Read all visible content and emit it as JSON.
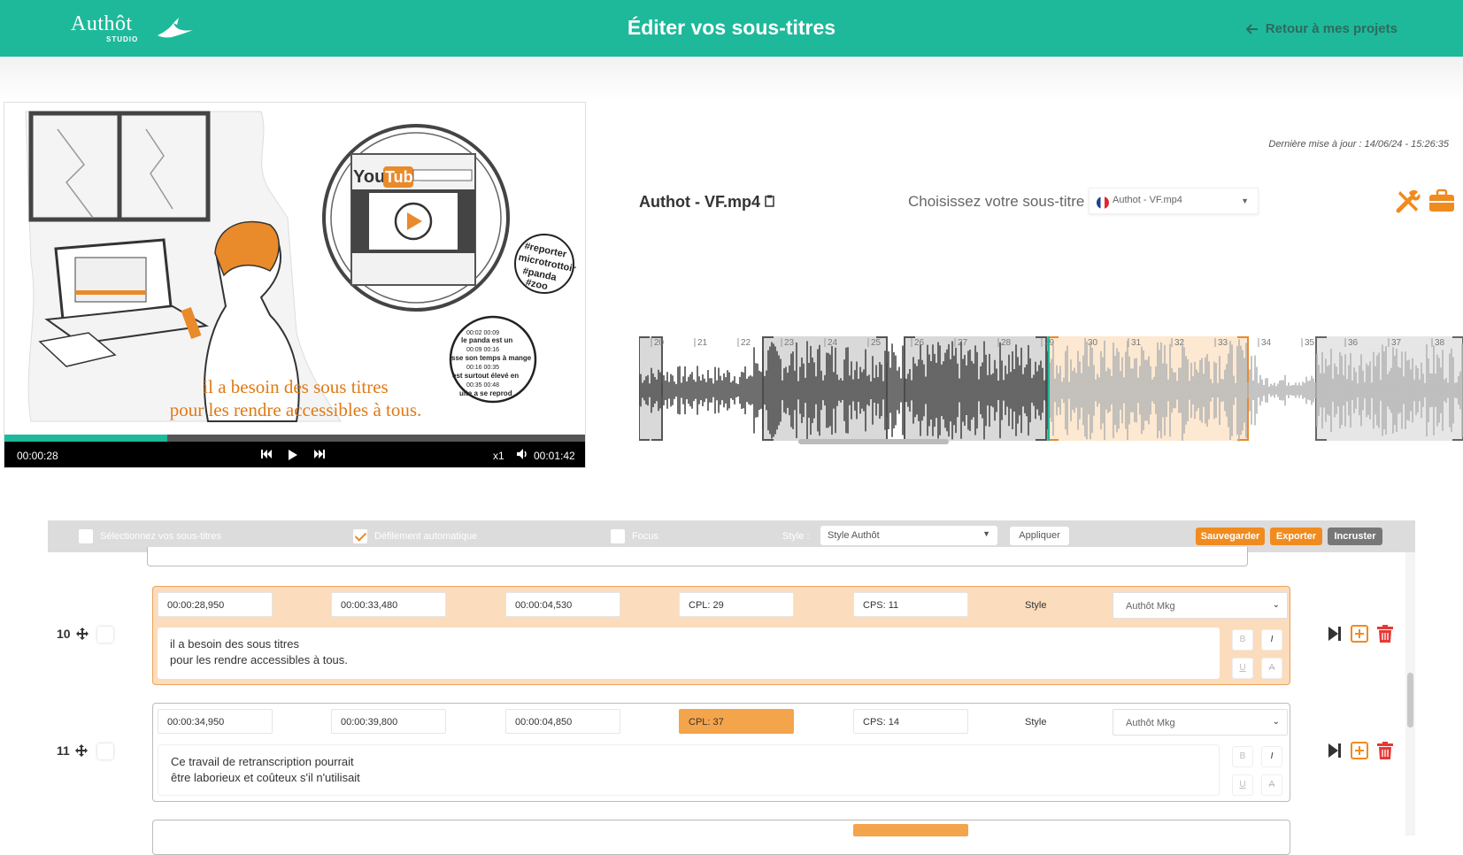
{
  "header": {
    "logo_text": "Authôt",
    "logo_sub": "STUDIO",
    "title": "Éditer vos sous-titres",
    "back_label": "Retour à mes projets"
  },
  "video": {
    "caption_line1": "il a besoin des sous titres",
    "caption_line2": "pour les rendre accessibles à tous.",
    "current_time": "00:00:28",
    "duration": "00:01:42",
    "speed": "x1",
    "progress": 0.28
  },
  "project": {
    "last_update": "Dernière mise à jour : 14/06/24 - 15:26:35",
    "filename": "Authot - VF.mp4",
    "choose_label": "Choisissez votre sous-titre",
    "selected_subtitle": "Authot - VF.mp4"
  },
  "waveform": {
    "ticks": [
      "20",
      "21",
      "22",
      "23",
      "24",
      "25",
      "26",
      "27",
      "28",
      "29",
      "30",
      "31",
      "32",
      "33",
      "34",
      "35",
      "36",
      "37",
      "38"
    ]
  },
  "toolbar": {
    "select_all": "Sélectionnez vos sous-titres",
    "auto_scroll": "Défilement automatique",
    "focus": "Focus",
    "style_label": "Style :",
    "style_value": "Style Authôt",
    "apply": "Appliquer",
    "save": "Sauvegarder",
    "export": "Exporter",
    "burn": "Incruster"
  },
  "subtitles": [
    {
      "number": "10",
      "start": "00:00:28,950",
      "end": "00:00:33,480",
      "duration": "00:00:04,530",
      "cpl": "CPL: 29",
      "cps": "CPS: 11",
      "style_label": "Style",
      "style": "Authôt Mkg",
      "line1": "il a besoin des sous titres",
      "line2": "pour les rendre accessibles à tous."
    },
    {
      "number": "11",
      "start": "00:00:34,950",
      "end": "00:00:39,800",
      "duration": "00:00:04,850",
      "cpl": "CPL: 37",
      "cps": "CPS: 14",
      "style_label": "Style",
      "style": "Authôt Mkg",
      "line1": "Ce travail de retranscription pourrait",
      "line2": "être laborieux et coûteux s'il n'utilisait"
    }
  ],
  "format_buttons": {
    "bold": "B",
    "italic": "I",
    "underline": "U",
    "strike": "A"
  },
  "colors": {
    "brand": "#1eb99a",
    "accent": "#f08b1f",
    "active_row": "#fbdcbc",
    "warning_field": "#f4a44b",
    "delete": "#e53935"
  }
}
